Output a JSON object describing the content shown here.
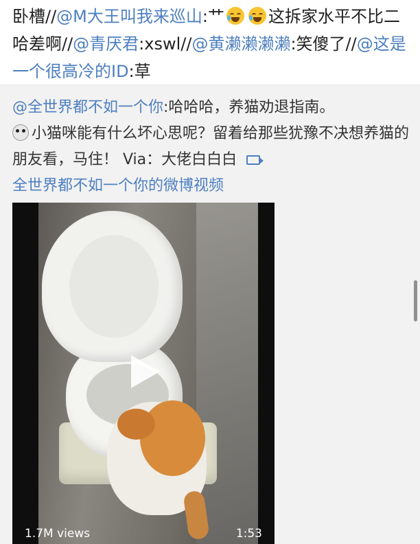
{
  "repost": {
    "t1": "卧槽//",
    "m1": "@M大王叫我来巡山",
    "t2": ":艹",
    "t3": "这拆家水平不比二哈差啊//",
    "m2": "@青厌君",
    "t4": ":xswl//",
    "m3": "@黄濑濑濑濑",
    "t5": ":笑傻了//",
    "m4": "@这是一个很高冷的ID",
    "t6": ":草"
  },
  "original": {
    "author": "@全世界都不如一个你",
    "t1": ":哈哈哈，养猫劝退指南。",
    "t2": "小猫咪能有什么坏心思呢？留着给那些犹豫不决想养猫的朋友看，马住！ Via：大佬白白白",
    "link": "全世界都不如一个你的微博视频"
  },
  "video": {
    "views": "1.7M views",
    "duration": "1:53"
  },
  "icons": {
    "emoji": "laugh-cry-emoji",
    "face": "scared-face-emoji",
    "video": "video-link-icon",
    "play": "play-icon"
  },
  "colors": {
    "mention": "#4d7fbf",
    "text": "#222222",
    "original_bg": "#f2f2f2"
  }
}
